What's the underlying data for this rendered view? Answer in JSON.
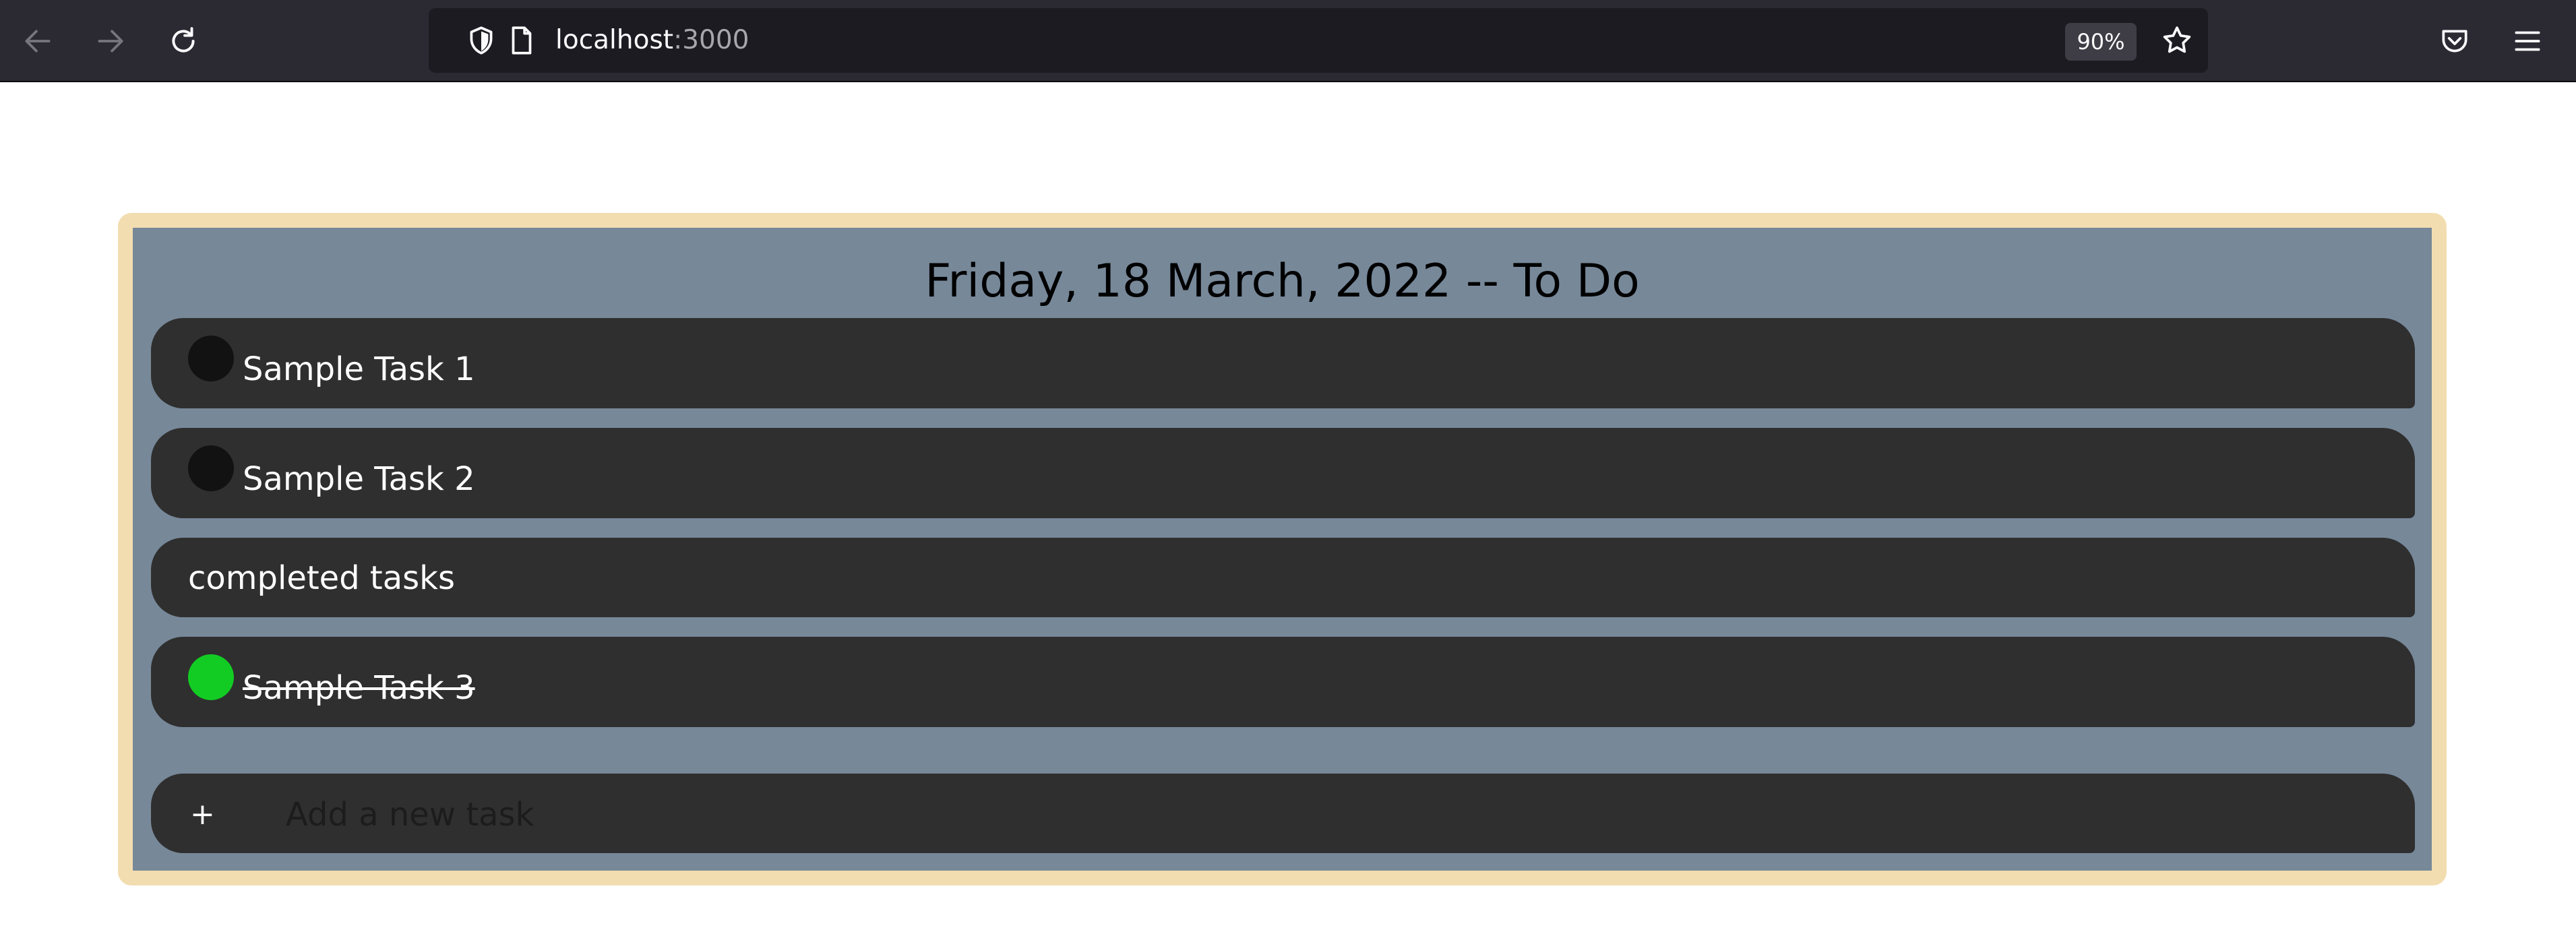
{
  "browser": {
    "url_host": "localhost",
    "url_port": ":3000",
    "zoom": "90%",
    "icons": {
      "back": "arrow-left-icon",
      "forward": "arrow-right-icon",
      "reload": "reload-icon",
      "shield": "shield-icon",
      "page": "page-icon",
      "bookmark": "star-icon",
      "pocket": "pocket-icon",
      "menu": "hamburger-menu-icon"
    }
  },
  "app": {
    "title": "Friday, 18 March, 2022 -- To Do",
    "tasks": [
      {
        "label": "Sample Task 1",
        "done": false
      },
      {
        "label": "Sample Task 2",
        "done": false
      }
    ],
    "completed_label": "completed tasks",
    "completed_tasks": [
      {
        "label": "Sample Task 3",
        "done": true
      }
    ],
    "add": {
      "plus": "+",
      "placeholder": "Add a new task"
    },
    "colors": {
      "card_border": "#f2ddb0",
      "card_bg": "#778899",
      "row_bg": "#2f2f2f",
      "check_done": "#12cc23",
      "check_pending": "#121212"
    }
  }
}
